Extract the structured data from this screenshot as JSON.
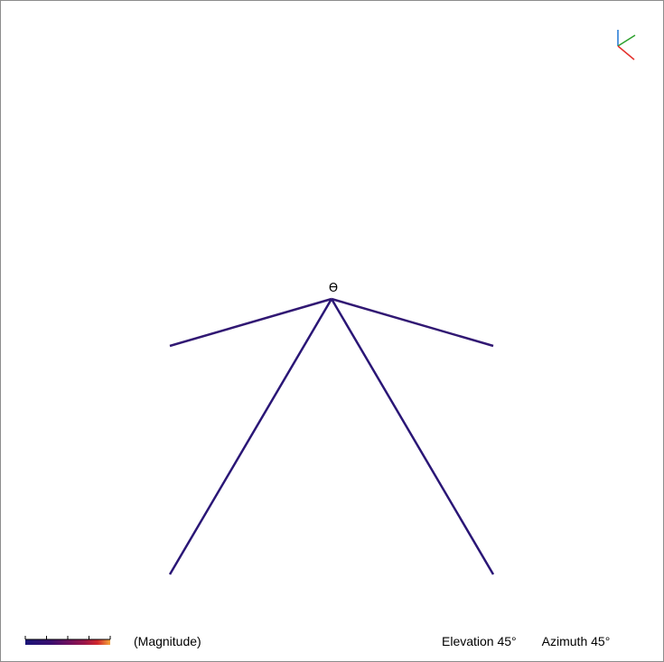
{
  "colorbar": {
    "label": "(Magnitude)",
    "colors": [
      "#1a1477",
      "#3a0e6e",
      "#6b0f5e",
      "#9a1548",
      "#d0262c",
      "#f5a53a"
    ]
  },
  "view": {
    "elevation_label": "Elevation 45°",
    "azimuth_label": "Azimuth 45°"
  },
  "triad": {
    "x_color": "#e4302c",
    "y_color": "#2ca02c",
    "z_color": "#1f77d4"
  },
  "node_marker": "ϴ",
  "structure": {
    "base_color": "#1f1577",
    "mast_gradient": [
      "#1f1577",
      "#5a0f6a",
      "#b21940",
      "#d92f2a",
      "#f3a83a",
      "#f9d040"
    ]
  }
}
